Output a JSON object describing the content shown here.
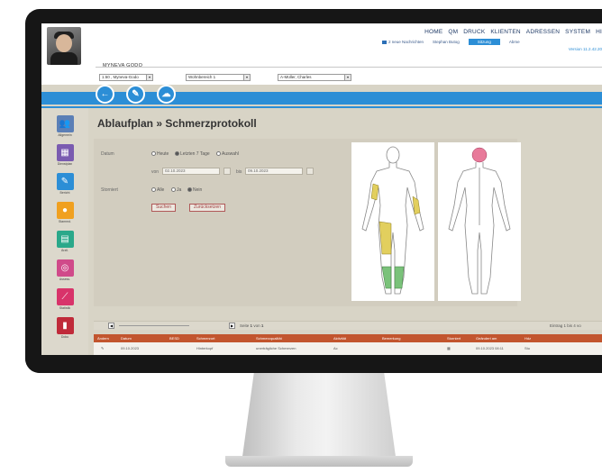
{
  "header": {
    "nav": [
      "HOME",
      "QM",
      "DRUCK",
      "KLIENTEN",
      "ADRESSEN",
      "SYSTEM",
      "HI"
    ],
    "messages": "2 neue Nachrichten",
    "user": "Stephan Butog",
    "session": "Sitzung",
    "logout": "Abme",
    "version": "Version 11.2.42.20"
  },
  "client": {
    "name": "MYNEVA GODO",
    "select_client": "1.50 , Myneva-Godo",
    "select_area": "Wohnbereich 1",
    "select_staff": "A-Müller, Charles"
  },
  "toolbar": {
    "back_icon": "←",
    "edit_icon": "✎",
    "cloud_icon": "☁"
  },
  "sidebar": {
    "items": [
      {
        "label": "Allgemein",
        "color": "#5b7fb6",
        "icon": "👥"
      },
      {
        "label": "Dienstplan",
        "color": "#7a5bb0",
        "icon": "▦"
      },
      {
        "label": "Bericht",
        "color": "#2c8ed6",
        "icon": "✎"
      },
      {
        "label": "Stammd.",
        "color": "#f0a020",
        "icon": "●"
      },
      {
        "label": "Ärztl.",
        "color": "#2aa88a",
        "icon": "▤"
      },
      {
        "label": "Assess.",
        "color": "#d04a8a",
        "icon": "◎"
      },
      {
        "label": "Statistik",
        "color": "#d8336a",
        "icon": "⟋"
      },
      {
        "label": "Doku",
        "color": "#c02a3a",
        "icon": "▮"
      }
    ]
  },
  "page": {
    "title": "Ablaufplan » Schmerzprotokoll"
  },
  "form": {
    "datum_label": "Datum",
    "radio_heute": "Heute",
    "radio_letzten": "Letzten 7 Tage",
    "radio_auswahl": "Auswahl",
    "von_label": "von",
    "von_value": "02.10.2023",
    "bis_label": "bis",
    "bis_value": "09.10.2023",
    "storniert_label": "Storniert",
    "radio_alle": "Alle",
    "radio_ja": "Ja",
    "radio_nein": "Nein",
    "search_button": "Suchen",
    "reset_button": "Zurücksetzen"
  },
  "pager": {
    "page_label": "Seite",
    "page_current": "1",
    "page_of": "von",
    "page_total": "1",
    "entries": "Eintrag 1 bis 4 vo"
  },
  "table": {
    "columns": [
      "Ändern",
      "Datum",
      "BESD",
      "Schmerzort",
      "Schmerzqualität",
      "Aktivität",
      "Bemerkung",
      "Storniert",
      "Geändert am",
      "Hdz"
    ],
    "rows": [
      [
        "✎",
        "09.10.2023",
        "",
        "Hinterkopf",
        "unerträgliche Schmerzen",
        "Ac",
        "",
        "▦",
        "09.10.2023 08:11",
        "Stu"
      ]
    ]
  },
  "colors": {
    "accent": "#2c8ed6",
    "table_header": "#c2552e",
    "pain_yellow": "#e2cf5e",
    "pain_green": "#7ac27a",
    "pain_red": "#e87a9a"
  }
}
